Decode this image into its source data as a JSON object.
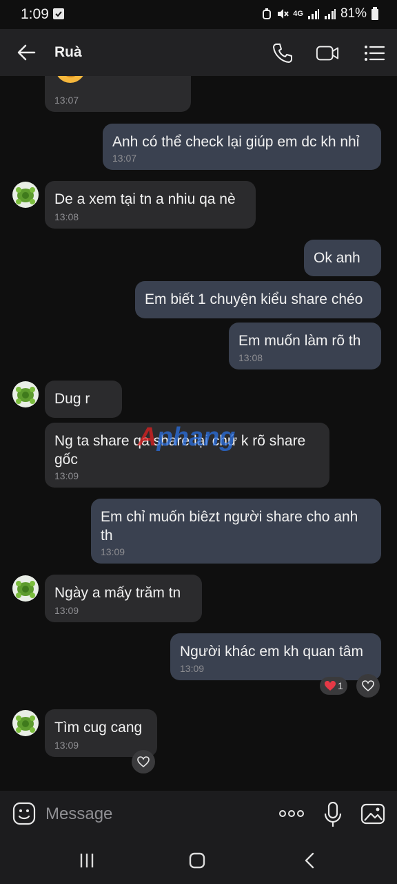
{
  "status_bar": {
    "time": "1:09",
    "battery": "81%",
    "network": "4G"
  },
  "header": {
    "back_icon": "arrow-left-icon",
    "title": "Ruà",
    "actions": [
      "phone-icon",
      "video-call-icon",
      "menu-list-icon"
    ]
  },
  "messages": [
    {
      "dir": "in",
      "text": "",
      "time": "13:07",
      "note": "emoji partially visible"
    },
    {
      "dir": "out",
      "text": "Anh có thể check lại giúp em dc kh nhỉ",
      "time": "13:07"
    },
    {
      "dir": "in",
      "text": "De a xem tại tn a nhiu qa nè",
      "time": "13:08"
    },
    {
      "dir": "out",
      "text": "Ok anh",
      "time": ""
    },
    {
      "dir": "out",
      "text": "Em biết 1 chuyện kiểu share chéo",
      "time": ""
    },
    {
      "dir": "out",
      "text": "Em muốn làm rõ th",
      "time": "13:08"
    },
    {
      "dir": "in",
      "text": "Dug r",
      "time": ""
    },
    {
      "dir": "in",
      "text": "Ng ta share qa share lại chứ k rõ share gốc",
      "time": "13:09"
    },
    {
      "dir": "out",
      "text": "Em chỉ muốn biêzt người share cho anh th",
      "time": "13:09"
    },
    {
      "dir": "in",
      "text": "Ngày a mấy trăm tn",
      "time": "13:09"
    },
    {
      "dir": "out",
      "text": "Người khác em kh quan tâm",
      "time": "13:09",
      "reaction_count": "1"
    },
    {
      "dir": "in",
      "text": "Tìm cug cang",
      "time": "13:09"
    }
  ],
  "watermark": {
    "part1": "A",
    "part2": "phang"
  },
  "composer": {
    "placeholder": "Message",
    "icons": [
      "emoji-icon",
      "more-icon",
      "microphone-icon",
      "gallery-icon"
    ]
  },
  "nav": [
    "recent-apps-icon",
    "home-icon",
    "back-nav-icon"
  ],
  "colors": {
    "incoming": "#2b2b2d",
    "outgoing": "#3a4150",
    "background": "#0f0f0f"
  }
}
